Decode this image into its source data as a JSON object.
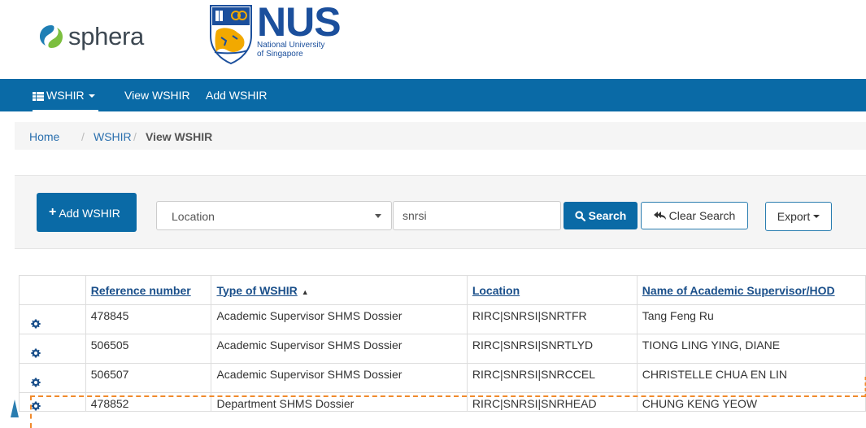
{
  "header": {
    "sphera_text": "sphera",
    "nus_word": "NUS",
    "nus_sub_line1": "National University",
    "nus_sub_line2": "of Singapore"
  },
  "navbar": {
    "brand": "WSHIR",
    "items": [
      "View WSHIR",
      "Add WSHIR"
    ],
    "bg_color": "#0a6aa6"
  },
  "breadcrumb": {
    "items": [
      "Home",
      "WSHIR",
      "View WSHIR"
    ],
    "separator": "/"
  },
  "toolbar": {
    "add_label": "Add WSHIR",
    "filter_selected": "Location",
    "search_value": "snrsi",
    "search_label": "Search",
    "clear_label": "Clear Search",
    "export_label": "Export"
  },
  "table": {
    "columns": [
      "Reference number",
      "Type of WSHIR",
      "Location",
      "Name of Academic Supervisor/HOD"
    ],
    "sorted_column": "Type of WSHIR",
    "sort_direction": "ascending",
    "rows": [
      {
        "ref": "478845",
        "type": "Academic Supervisor SHMS Dossier",
        "location": "RIRC|SNRSI|SNRTFR",
        "name": "Tang Feng Ru"
      },
      {
        "ref": "506505",
        "type": "Academic Supervisor SHMS Dossier",
        "location": "RIRC|SNRSI|SNRTLYD",
        "name": "TIONG LING YING, DIANE"
      },
      {
        "ref": "506507",
        "type": "Academic Supervisor SHMS Dossier",
        "location": "RIRC|SNRSI|SNRCCEL",
        "name": "CHRISTELLE CHUA EN LIN"
      },
      {
        "ref": "478852",
        "type": "Department SHMS Dossier",
        "location": "RIRC|SNRSI|SNRHEAD",
        "name": "CHUNG KENG YEOW"
      }
    ]
  },
  "colors": {
    "primary": "#0a6aa6",
    "highlight": "#f08a2c",
    "link": "#2a6fae"
  }
}
